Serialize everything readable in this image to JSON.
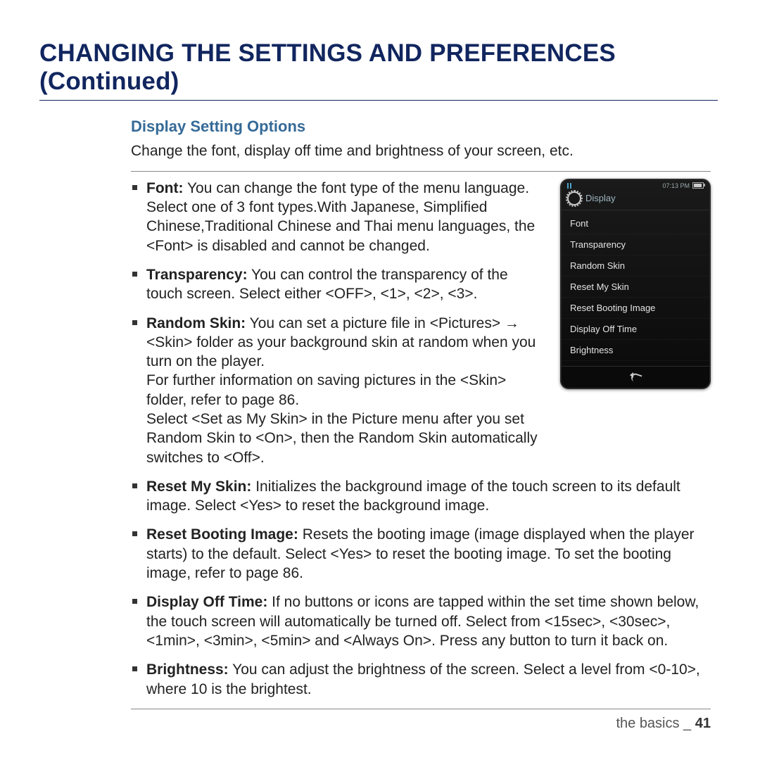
{
  "title": "CHANGING THE SETTINGS AND PREFERENCES (Continued)",
  "subhead": "Display Setting Options",
  "intro": "Change the font, display off time and brightness of your screen, etc.",
  "bullets_narrow": [
    {
      "label": "Font:",
      "text": " You can change the font type of the menu language. Select one of 3 font types.With Japanese, Simplified Chinese,Traditional Chinese and Thai menu languages, the <Font> is disabled and cannot be changed."
    },
    {
      "label": "Transparency:",
      "text": " You can control the transparency of the touch screen. Select either <OFF>, <1>, <2>, <3>."
    },
    {
      "label": "Random Skin:",
      "text": " You can set a picture file in <Pictures> → <Skin> folder as your background skin at random when you turn on the player.\nFor further information on saving pictures in the <Skin> folder, refer to page 86.\nSelect <Set as My Skin> in the Picture menu after you set Random Skin to <On>, then the Random Skin automatically switches to <Off>."
    }
  ],
  "bullets_wide": [
    {
      "label": "Reset My Skin:",
      "text": " Initializes the background image of the touch screen to its default image. Select <Yes> to reset the background image."
    },
    {
      "label": "Reset Booting Image:",
      "text": " Resets the booting image (image displayed when the player starts) to the default. Select <Yes> to reset the booting image. To set the booting image, refer to page 86."
    },
    {
      "label": "Display Off Time:",
      "text": " If no buttons or icons are tapped within the set time shown below, the touch screen will automatically be turned off. Select from <15sec>, <30sec>, <1min>, <3min>, <5min> and <Always On>. Press any button to turn it back on."
    },
    {
      "label": "Brightness:",
      "text": " You can adjust the brightness of the screen. Select a level from <0-10>, where 10 is the brightest."
    }
  ],
  "device": {
    "time": "07:13 PM",
    "screen_title": "Display",
    "menu": [
      "Font",
      "Transparency",
      "Random Skin",
      "Reset My Skin",
      "Reset Booting Image",
      "Display Off Time",
      "Brightness"
    ]
  },
  "footer": {
    "section": "the basics _",
    "page": "41"
  }
}
